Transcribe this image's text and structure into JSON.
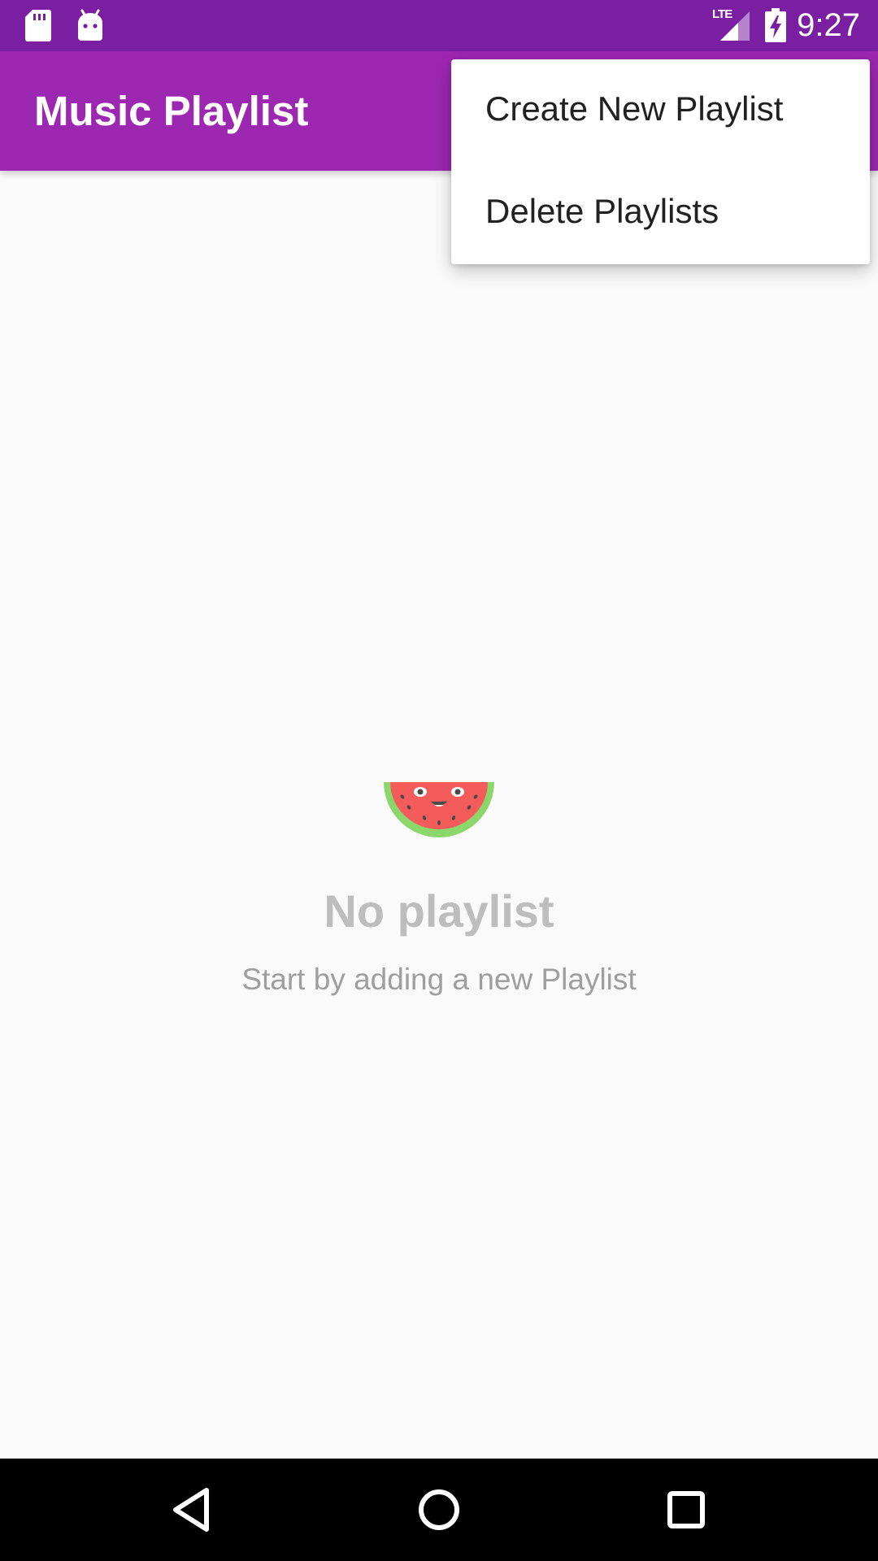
{
  "status_bar": {
    "time": "9:27",
    "network": "LTE",
    "icons": [
      "sd-card-icon",
      "android-debug-icon",
      "lte-signal-icon",
      "battery-charging-icon"
    ],
    "background_color": "#7B1FA2"
  },
  "app_bar": {
    "title": "Music Playlist",
    "background_color": "#9C27B0"
  },
  "overflow_menu": {
    "items": [
      {
        "label": "Create New Playlist"
      },
      {
        "label": "Delete Playlists"
      }
    ]
  },
  "empty_state": {
    "illustration": "watermelon-icon",
    "title": "No playlist",
    "subtitle": "Start by adding a new Playlist"
  },
  "nav_bar": {
    "buttons": [
      "back-icon",
      "home-icon",
      "recents-icon"
    ]
  }
}
